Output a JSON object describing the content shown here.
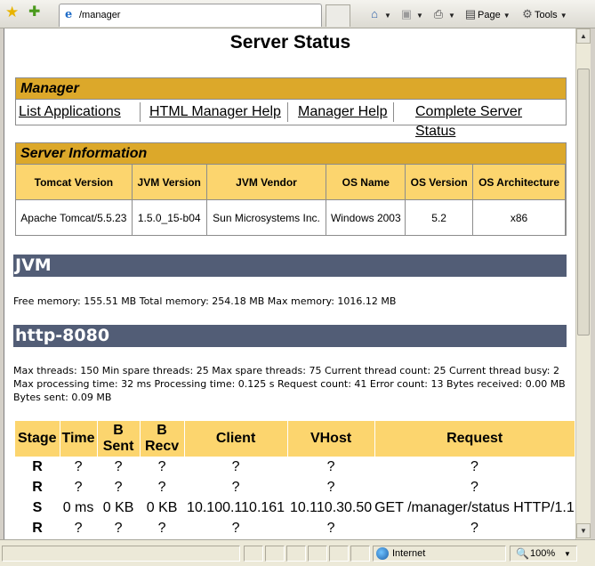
{
  "browser": {
    "tab_title": "/manager",
    "home_label": "",
    "page_label": "Page",
    "tools_label": "Tools"
  },
  "page": {
    "title": "Server Status"
  },
  "manager": {
    "heading": "Manager",
    "links": [
      "List Applications",
      "HTML Manager Help",
      "Manager Help",
      "Complete Server Status"
    ]
  },
  "server_info": {
    "heading": "Server Information",
    "headers": [
      "Tomcat Version",
      "JVM Version",
      "JVM Vendor",
      "OS Name",
      "OS Version",
      "OS Architecture"
    ],
    "values": [
      "Apache Tomcat/5.5.23",
      "1.5.0_15-b04",
      "Sun Microsystems Inc.",
      "Windows 2003",
      "5.2",
      "x86"
    ]
  },
  "jvm": {
    "heading": "JVM",
    "text": "Free memory: 155.51 MB Total memory: 254.18 MB Max memory: 1016.12 MB"
  },
  "connector": {
    "heading": "http-8080",
    "text": "Max threads: 150 Min spare threads: 25 Max spare threads: 75 Current thread count: 25 Current thread busy: 2 Max processing time: 32 ms Processing time: 0.125 s Request count: 41 Error count: 13 Bytes received: 0.00 MB Bytes sent: 0.09 MB"
  },
  "threads": {
    "headers": [
      "Stage",
      "Time",
      "B Sent",
      "B Recv",
      "Client",
      "VHost",
      "Request"
    ],
    "rows": [
      [
        "R",
        "?",
        "?",
        "?",
        "?",
        "?",
        "?"
      ],
      [
        "R",
        "?",
        "?",
        "?",
        "?",
        "?",
        "?"
      ],
      [
        "S",
        "0 ms",
        "0 KB",
        "0 KB",
        "10.100.110.161",
        "10.110.30.50",
        "GET /manager/status HTTP/1.1"
      ],
      [
        "R",
        "?",
        "?",
        "?",
        "?",
        "?",
        "?"
      ]
    ]
  },
  "status_bar": {
    "zone": "Internet",
    "zoom": "100%"
  }
}
